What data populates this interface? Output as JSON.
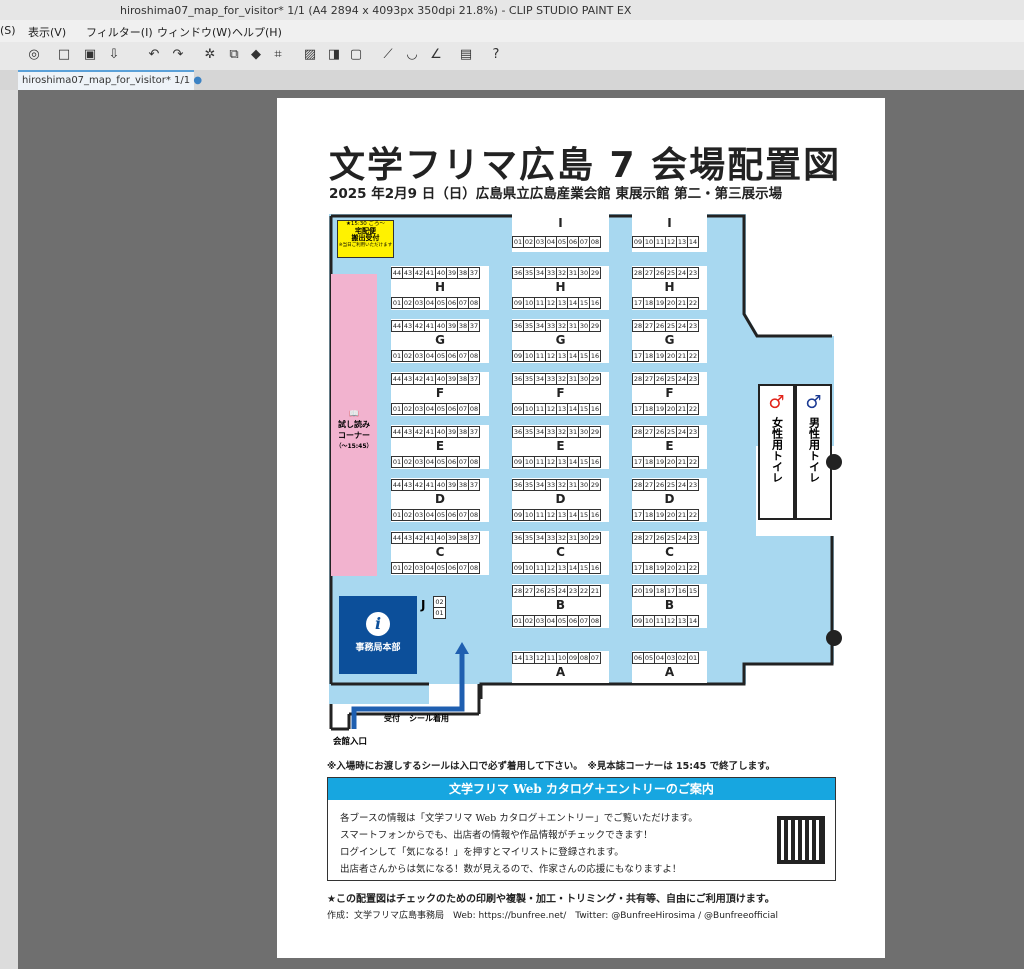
{
  "window": {
    "title": "hiroshima07_map_for_visitor* 1/1 (A4 2894 x 4093px 350dpi 21.8%) - CLIP STUDIO PAINT EX"
  },
  "menu": [
    "(S)",
    "表示(V)",
    "フィルター(I)",
    "ウィンドウ(W)",
    "ヘルプ(H)"
  ],
  "tab": {
    "label": "hiroshima07_map_for_visitor* 1/1",
    "dot": "●"
  },
  "doc": {
    "title": "文学フリマ広島 7 会場配置図",
    "subtitle": "2025 年2月9 日（日）広島県立広島産業会館 東展示館 第二・第三展示場",
    "delivery": {
      "line1": "★15:30 ごろ～",
      "line2": "宅配便",
      "line3": "搬出受付",
      "line4": "※当日ご利用いただけます"
    },
    "reading_corner": {
      "title": "試し読み",
      "title2": "コーナー",
      "time": "（～15:45）"
    },
    "office": {
      "icon": "i",
      "label": "事務局本部"
    },
    "reception": "受付",
    "seal": "シール着用",
    "entrance": "会館入口",
    "women_toilet": "女性用トイレ",
    "men_toilet": "男性用トイレ",
    "blocks": [
      {
        "label": "I",
        "top": [],
        "bottom": [
          "01",
          "02",
          "03",
          "04",
          "05",
          "06",
          "07",
          "08"
        ]
      },
      {
        "label": "I",
        "top": [],
        "bottom": [
          "09",
          "10",
          "11",
          "12",
          "13",
          "14"
        ]
      }
    ],
    "rows": {
      "left_top": [
        "44",
        "43",
        "42",
        "41",
        "40",
        "39",
        "38",
        "37"
      ],
      "left_bot": [
        "01",
        "02",
        "03",
        "04",
        "05",
        "06",
        "07",
        "08"
      ],
      "mid_top": [
        "36",
        "35",
        "34",
        "33",
        "32",
        "31",
        "30",
        "29"
      ],
      "mid_bot": [
        "09",
        "10",
        "11",
        "12",
        "13",
        "14",
        "15",
        "16"
      ],
      "right_top": [
        "28",
        "27",
        "26",
        "25",
        "24",
        "23"
      ],
      "right_bot": [
        "17",
        "18",
        "19",
        "20",
        "21",
        "22"
      ]
    },
    "letters": [
      "H",
      "G",
      "F",
      "E",
      "D",
      "C"
    ],
    "b_mid_top": [
      "28",
      "27",
      "26",
      "25",
      "24",
      "23",
      "22",
      "21"
    ],
    "b_mid_bot": [
      "01",
      "02",
      "03",
      "04",
      "05",
      "06",
      "07",
      "08"
    ],
    "b_right_top": [
      "20",
      "19",
      "18",
      "17",
      "16",
      "15"
    ],
    "b_right_bot": [
      "09",
      "10",
      "11",
      "12",
      "13",
      "14"
    ],
    "a_mid": [
      "14",
      "13",
      "12",
      "11",
      "10",
      "09",
      "08",
      "07"
    ],
    "a_right": [
      "06",
      "05",
      "04",
      "03",
      "02",
      "01"
    ],
    "j_label": "J",
    "j_cells": [
      "02",
      "01"
    ],
    "b_label": "B",
    "a_label": "A",
    "note": "※入場時にお渡しするシールは入口で必ず着用して下さい。　※見本誌コーナーは 15:45 で終了します。",
    "catalog_head": "文学フリマ Web カタログ＋エントリーのご案内",
    "catalog_lines": [
      "各ブースの情報は「文学フリマ Web カタログ＋エントリー」でご覧いただけます。",
      "スマートフォンからでも、出店者の情報や作品情報がチェックできます！",
      "ログインして「気になる！」を押すとマイリストに登録されます。",
      "出店者さんからは気になる！数が見えるので、作家さんの応援にもなりますよ！"
    ],
    "footer1": "★この配置図はチェックのための印刷や複製・加工・トリミング・共有等、自由にご利用頂けます。",
    "footer2": "作成：文学フリマ広島事務局　Web: https://bunfree.net/　Twitter: @BunfreeHirosima / @Bunfreeofficial"
  },
  "colors": {
    "floor": "#a8d8f0",
    "pink": "#f2b3cf",
    "office": "#0c4f9a",
    "catalog": "#17a6e0"
  }
}
